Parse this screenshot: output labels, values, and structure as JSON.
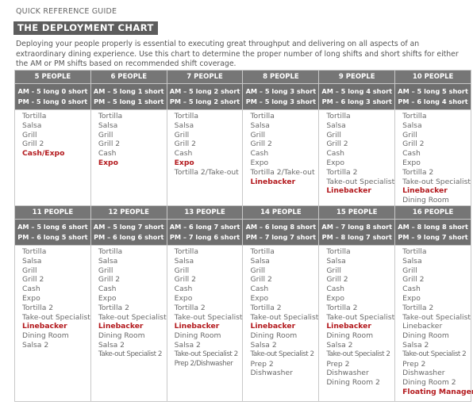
{
  "header": {
    "kicker": "QUICK REFERENCE GUIDE",
    "title": "THE DEPLOYMENT CHART",
    "intro": "Deploying your people properly is essential to executing great throughput and delivering on all aspects of an extraordinary dining experience.  Use this chart to determine the proper number of long shifts and short shifts for either the AM or PM shifts based on recommended shift coverage."
  },
  "colors": {
    "header_bg": "#767676",
    "highlight": "#b3191d",
    "text": "#6a6a6a"
  },
  "chart_data": {
    "type": "table",
    "title": "THE DEPLOYMENT CHART",
    "columns": [
      {
        "people": "5 PEOPLE",
        "am": "AM - 5 long 0 short",
        "pm": "PM - 5 long 0 short",
        "roles": [
          {
            "t": "Tortilla"
          },
          {
            "t": "Salsa"
          },
          {
            "t": "Grill"
          },
          {
            "t": "Grill 2"
          },
          {
            "t": "Cash/Expo",
            "hl": true
          }
        ]
      },
      {
        "people": "6 PEOPLE",
        "am": "AM – 5 long 1 short",
        "pm": "PM – 5 long 1 short",
        "roles": [
          {
            "t": "Tortilla"
          },
          {
            "t": "Salsa"
          },
          {
            "t": "Grill"
          },
          {
            "t": "Grill 2"
          },
          {
            "t": "Cash"
          },
          {
            "t": "Expo",
            "hl": true
          }
        ]
      },
      {
        "people": "7 PEOPLE",
        "am": "AM – 5 long 2 short",
        "pm": "PM – 5 long 2 short",
        "roles": [
          {
            "t": "Tortilla"
          },
          {
            "t": "Salsa"
          },
          {
            "t": "Grill"
          },
          {
            "t": "Grill 2"
          },
          {
            "t": "Cash"
          },
          {
            "t": "Expo",
            "hl": true
          },
          {
            "t": "Tortilla 2/Take-out"
          }
        ]
      },
      {
        "people": "8 PEOPLE",
        "am": "AM – 5 long 3 short",
        "pm": "PM – 5 long 3 short",
        "roles": [
          {
            "t": "Tortilla"
          },
          {
            "t": "Salsa"
          },
          {
            "t": "Grill"
          },
          {
            "t": "Grill 2"
          },
          {
            "t": "Cash"
          },
          {
            "t": "Expo"
          },
          {
            "t": "Tortilla 2/Take-out"
          },
          {
            "t": "Linebacker",
            "hl": true
          }
        ]
      },
      {
        "people": "9 PEOPLE",
        "am": "AM – 5 long 4 short",
        "pm": "PM – 6 long 3 short",
        "roles": [
          {
            "t": "Tortilla"
          },
          {
            "t": "Salsa"
          },
          {
            "t": "Grill"
          },
          {
            "t": "Grill 2"
          },
          {
            "t": "Cash"
          },
          {
            "t": "Expo"
          },
          {
            "t": "Tortilla 2"
          },
          {
            "t": "Take-out Specialist"
          },
          {
            "t": "Linebacker",
            "hl": true
          }
        ]
      },
      {
        "people": "10 PEOPLE",
        "am": "AM – 5 long 5 short",
        "pm": "PM – 6 long 4 short",
        "roles": [
          {
            "t": "Tortilla"
          },
          {
            "t": "Salsa"
          },
          {
            "t": "Grill"
          },
          {
            "t": "Grill 2"
          },
          {
            "t": "Cash"
          },
          {
            "t": "Expo"
          },
          {
            "t": "Tortilla 2"
          },
          {
            "t": "Take-out Specialist"
          },
          {
            "t": "Linebacker",
            "hl": true
          },
          {
            "t": "Dining Room"
          }
        ]
      },
      {
        "people": "11 PEOPLE",
        "am": "AM – 5 long 6 short",
        "pm": "PM – 6 long 5 short",
        "roles": [
          {
            "t": "Tortilla"
          },
          {
            "t": "Salsa"
          },
          {
            "t": "Grill"
          },
          {
            "t": "Grill 2"
          },
          {
            "t": "Cash"
          },
          {
            "t": "Expo"
          },
          {
            "t": "Tortilla 2"
          },
          {
            "t": "Take-out Specialist"
          },
          {
            "t": "Linebacker",
            "hl": true
          },
          {
            "t": "Dining Room"
          },
          {
            "t": "Salsa 2"
          }
        ]
      },
      {
        "people": "12 PEOPLE",
        "am": "AM – 5 long 7 short",
        "pm": "PM – 6 long 6 short",
        "roles": [
          {
            "t": "Tortilla"
          },
          {
            "t": "Salsa"
          },
          {
            "t": "Grill"
          },
          {
            "t": "Grill 2"
          },
          {
            "t": "Cash"
          },
          {
            "t": "Expo"
          },
          {
            "t": "Tortilla 2"
          },
          {
            "t": "Take-out Specialist"
          },
          {
            "t": "Linebacker",
            "hl": true
          },
          {
            "t": "Dining Room"
          },
          {
            "t": "Salsa 2"
          },
          {
            "t": "Take-out Specialist 2",
            "cond": true
          }
        ]
      },
      {
        "people": "13 PEOPLE",
        "am": "AM – 6 long 7 short",
        "pm": "PM – 7 long 6 short",
        "roles": [
          {
            "t": "Tortilla"
          },
          {
            "t": "Salsa"
          },
          {
            "t": "Grill"
          },
          {
            "t": "Grill 2"
          },
          {
            "t": "Cash"
          },
          {
            "t": "Expo"
          },
          {
            "t": "Tortilla 2"
          },
          {
            "t": "Take-out Specialist"
          },
          {
            "t": "Linebacker",
            "hl": true
          },
          {
            "t": "Dining Room"
          },
          {
            "t": "Salsa 2"
          },
          {
            "t": "Take-out Specialist 2",
            "cond": true
          },
          {
            "t": "Prep 2/Dishwasher",
            "cond": true
          }
        ]
      },
      {
        "people": "14 PEOPLE",
        "am": "AM – 6 long 8 short",
        "pm": "PM – 7 long 7 short",
        "roles": [
          {
            "t": "Tortilla"
          },
          {
            "t": "Salsa"
          },
          {
            "t": "Grill"
          },
          {
            "t": "Grill 2"
          },
          {
            "t": "Cash"
          },
          {
            "t": "Expo"
          },
          {
            "t": "Tortilla 2"
          },
          {
            "t": "Take-out Specialist"
          },
          {
            "t": "Linebacker",
            "hl": true
          },
          {
            "t": "Dining Room"
          },
          {
            "t": "Salsa 2"
          },
          {
            "t": "Take-out Specialist 2",
            "cond": true
          },
          {
            "t": "Prep 2"
          },
          {
            "t": "Dishwasher"
          }
        ]
      },
      {
        "people": "15 PEOPLE",
        "am": "AM – 7 long 8 short",
        "pm": "PM – 8 long 7 short",
        "roles": [
          {
            "t": "Tortilla"
          },
          {
            "t": "Salsa"
          },
          {
            "t": "Grill"
          },
          {
            "t": "Grill 2"
          },
          {
            "t": "Cash"
          },
          {
            "t": "Expo"
          },
          {
            "t": "Tortilla 2"
          },
          {
            "t": "Take-out Specialist"
          },
          {
            "t": "Linebacker",
            "hl": true
          },
          {
            "t": "Dining Room"
          },
          {
            "t": "Salsa 2"
          },
          {
            "t": "Take-out Specialist 2",
            "cond": true
          },
          {
            "t": "Prep 2"
          },
          {
            "t": "Dishwasher"
          },
          {
            "t": "Dining Room 2"
          }
        ]
      },
      {
        "people": "16 PEOPLE",
        "am": "AM – 8 long 8 short",
        "pm": "PM – 9 long 7 short",
        "roles": [
          {
            "t": "Tortilla"
          },
          {
            "t": "Salsa"
          },
          {
            "t": "Grill"
          },
          {
            "t": "Grill 2"
          },
          {
            "t": "Cash"
          },
          {
            "t": "Expo"
          },
          {
            "t": "Tortilla 2"
          },
          {
            "t": "Take-out Specialist"
          },
          {
            "t": "Linebacker"
          },
          {
            "t": "Dining Room"
          },
          {
            "t": "Salsa 2"
          },
          {
            "t": "Take-out Specialist 2",
            "cond": true
          },
          {
            "t": "Prep 2"
          },
          {
            "t": "Dishwasher"
          },
          {
            "t": "Dining Room 2"
          },
          {
            "t": "Floating Manager",
            "hl": true
          }
        ]
      }
    ]
  }
}
